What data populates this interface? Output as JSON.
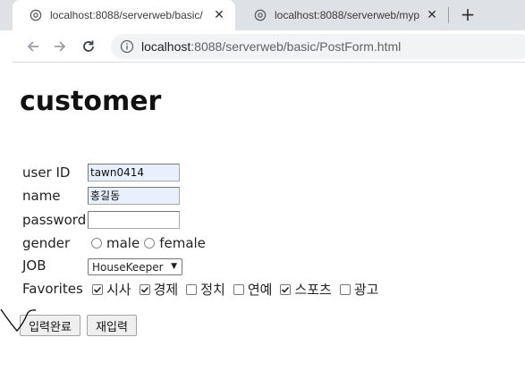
{
  "browser": {
    "tabs": [
      {
        "title": "localhost:8088/serverweb/basic/",
        "close": "✕",
        "active": true
      },
      {
        "title": "localhost:8088/serverweb/mypo",
        "close": "✕",
        "active": false
      }
    ],
    "new_tab": "+",
    "address": {
      "host": "localhost",
      "path": ":8088/serverweb/basic/PostForm.html"
    }
  },
  "page": {
    "heading": "customer",
    "fields": {
      "userid_label": "user ID",
      "userid_value": "tawn0414",
      "name_label": "name",
      "name_value": "홍길동",
      "password_label": "password",
      "password_value": "",
      "gender_label": "gender",
      "gender_options": [
        "male",
        "female"
      ],
      "job_label": "JOB",
      "job_selected": "HouseKeeper",
      "favorites_label": "Favorites",
      "favorites": [
        {
          "label": "시사",
          "checked": true
        },
        {
          "label": "경제",
          "checked": true
        },
        {
          "label": "정치",
          "checked": false
        },
        {
          "label": "연예",
          "checked": false
        },
        {
          "label": "스포츠",
          "checked": true
        },
        {
          "label": "광고",
          "checked": false
        }
      ]
    },
    "buttons": {
      "submit": "입력완료",
      "reset": "재입력"
    }
  }
}
